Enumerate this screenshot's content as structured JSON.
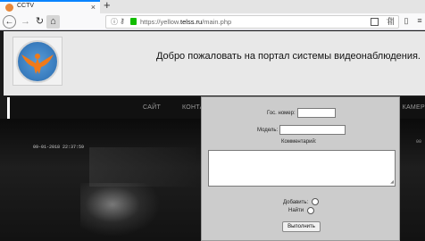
{
  "browser": {
    "tab_title": "CCTV",
    "tab_close": "×",
    "new_tab": "+",
    "url_prefix": "https://yellow.",
    "url_domain": "telss.ru",
    "url_path": "/main.php",
    "accent_color": "#0a84ff"
  },
  "header": {
    "welcome": "Добро пожаловать на портал системы видеонаблюдения."
  },
  "menu": {
    "site": "САЙТ",
    "contacts": "КОНТА",
    "cameras": "КАМЕР"
  },
  "video": {
    "timestamp": "09-01-2018 22:37:59",
    "timestamp2": "00"
  },
  "form": {
    "plate_label": "Гос. номер:",
    "plate_value": "",
    "model_label": "Модель:",
    "model_value": "",
    "comment_label": "Комментарий:",
    "comment_value": "",
    "add_label": "Добавить:",
    "find_label": "Найти",
    "submit_label": "Выполнить"
  }
}
